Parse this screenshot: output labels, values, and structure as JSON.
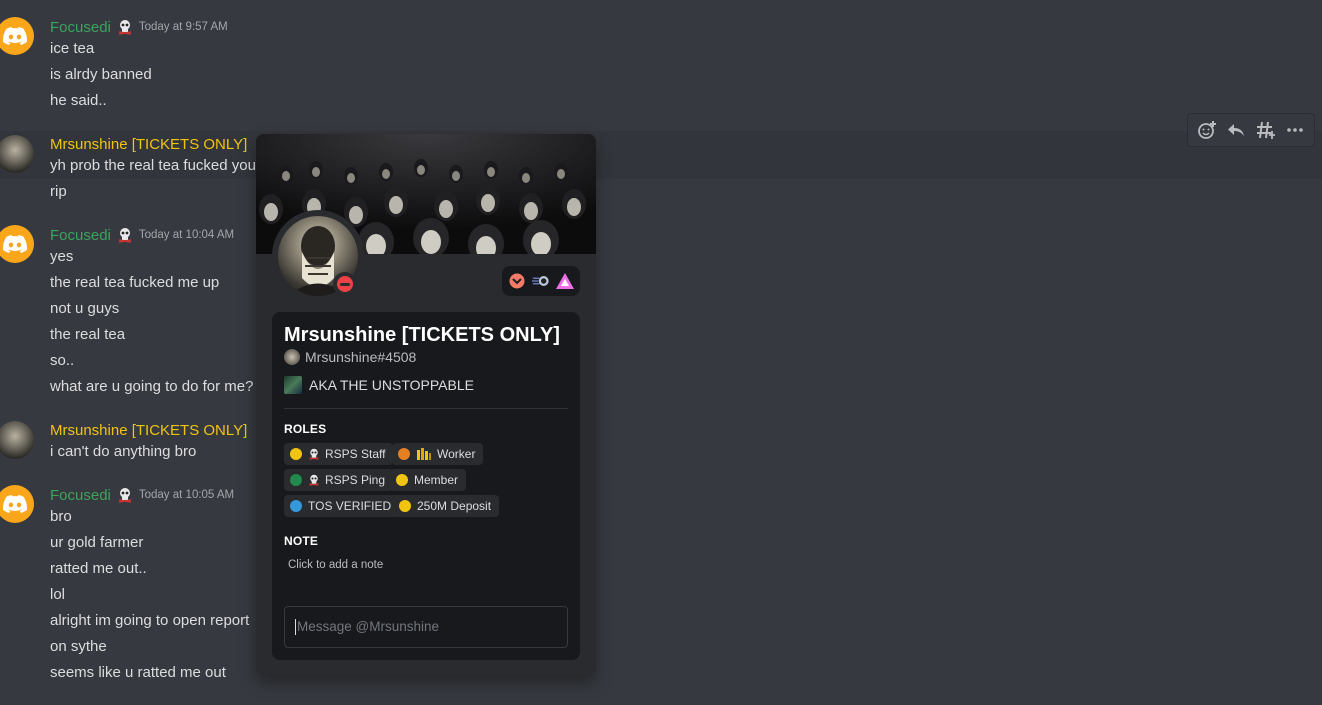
{
  "messages": [
    {
      "author": "Focusedi",
      "time": "Today at 9:57 AM",
      "lines": [
        "ice tea",
        "is alrdy banned",
        "he said.."
      ]
    },
    {
      "author": "Mrsunshine [TICKETS ONLY]",
      "lines": [
        "yh prob the real tea fucked you",
        "rip"
      ]
    },
    {
      "author": "Focusedi",
      "time": "Today at 10:04 AM",
      "lines": [
        "yes",
        "the real tea fucked me up",
        "not u guys",
        "the real tea",
        "so..",
        "what are u going to do for me?"
      ]
    },
    {
      "author": "Mrsunshine [TICKETS ONLY]",
      "lines": [
        "i can't do anything bro"
      ]
    },
    {
      "author": "Focusedi",
      "time": "Today at 10:05 AM",
      "lines": [
        "bro",
        "ur gold farmer",
        "ratted me out..",
        "lol",
        "alright im going to open report",
        "on sythe",
        "seems like u ratted me out"
      ]
    }
  ],
  "toolbar": {
    "icons": [
      "add-reaction-icon",
      "reply-icon",
      "create-thread-icon",
      "more-icon"
    ]
  },
  "profile": {
    "display_name": "Mrsunshine [TICKETS ONLY]",
    "tag": "Mrsunshine#4508",
    "custom_status": "AKA THE UNSTOPPABLE",
    "status": "do-not-disturb",
    "badges": [
      "nitro-boost-badge",
      "hypesquad-balance-badge",
      "bravery-triangle-badge"
    ],
    "roles_title": "ROLES",
    "roles": [
      {
        "label": "RSPS Staff",
        "color": "#f1c40f",
        "icon": "skull-icon"
      },
      {
        "label": "Worker",
        "color": "#e67e22",
        "icon": "gold-bars-icon"
      },
      {
        "label": "RSPS Ping",
        "color": "#1f8b4c",
        "icon": "skull-icon"
      },
      {
        "label": "Member",
        "color": "#f1c40f",
        "icon": ""
      },
      {
        "label": "TOS VERIFIED",
        "color": "#3498db",
        "icon": ""
      },
      {
        "label": "250M Deposit",
        "color": "#f1c40f",
        "icon": ""
      }
    ],
    "note_title": "NOTE",
    "note_placeholder": "Click to add a note",
    "message_placeholder": "Message @Mrsunshine"
  },
  "colors": {
    "background": "#36393f",
    "popout": "#292b2f",
    "card": "#18191c",
    "focusedi_name": "#3ba55c",
    "mrsunshine_name": "#f1c40f",
    "dnd": "#ed4245"
  }
}
